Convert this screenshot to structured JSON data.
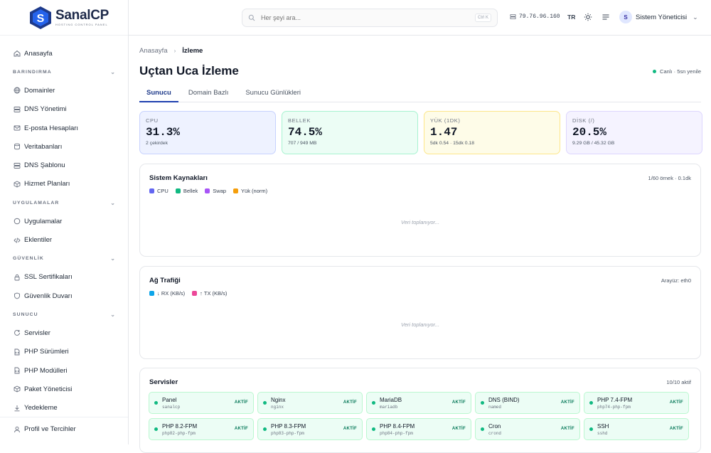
{
  "brand": {
    "name": "SanalCP",
    "tagline": "HOSTING CONTROL PANEL"
  },
  "sidebar": {
    "home": "Anasayfa",
    "sections": [
      {
        "label": "BARINDIRMA",
        "items": [
          "Domainler",
          "DNS Yönetimi",
          "E-posta Hesapları",
          "Veritabanları",
          "DNS Şablonu",
          "Hizmet Planları"
        ]
      },
      {
        "label": "UYGULAMALAR",
        "items": [
          "Uygulamalar",
          "Eklentiler"
        ]
      },
      {
        "label": "GÜVENLİK",
        "items": [
          "SSL Sertifikaları",
          "Güvenlik Duvarı"
        ]
      },
      {
        "label": "SUNUCU",
        "items": [
          "Servisler",
          "PHP Sürümleri",
          "PHP Modülleri",
          "Paket Yöneticisi",
          "Yedekleme"
        ]
      }
    ],
    "profile": "Profil ve Tercihler"
  },
  "topbar": {
    "search_placeholder": "Her şeyi ara...",
    "search_shortcut": "Ctrl K",
    "ip": "79.76.96.160",
    "lang": "TR",
    "user_initial": "S",
    "user_name": "Sistem Yöneticisi"
  },
  "breadcrumb": {
    "home": "Anasayfa",
    "current": "İzleme"
  },
  "page": {
    "title": "Uçtan Uca İzleme",
    "live": "Canlı · 5sn yenile"
  },
  "tabs": [
    "Sunucu",
    "Domain Bazlı",
    "Sunucu Günlükleri"
  ],
  "stats": [
    {
      "label": "CPU",
      "value": "31.3%",
      "sub": "2 çekirdek",
      "bg": "#eef2ff",
      "border": "#c7d2fe"
    },
    {
      "label": "BELLEK",
      "value": "74.5%",
      "sub": "707 / 949 MB",
      "bg": "#ecfdf5",
      "border": "#a7f3d0"
    },
    {
      "label": "YÜK (1DK)",
      "value": "1.47",
      "sub": "5dk 0.54 · 15dk 0.18",
      "bg": "#fefce8",
      "border": "#fde68a"
    },
    {
      "label": "DİSK (/)",
      "value": "20.5%",
      "sub": "9.29 GB / 45.32 GB",
      "bg": "#f5f3ff",
      "border": "#ddd6fe"
    }
  ],
  "resources": {
    "title": "Sistem Kaynakları",
    "meta": "1/60 örnek · 0.1dk",
    "legend": [
      {
        "label": "CPU",
        "color": "#6366f1"
      },
      {
        "label": "Bellek",
        "color": "#10b981"
      },
      {
        "label": "Swap",
        "color": "#a855f7"
      },
      {
        "label": "Yük (norm)",
        "color": "#f59e0b"
      }
    ],
    "empty": "Veri toplanıyor..."
  },
  "traffic": {
    "title": "Ağ Trafiği",
    "meta": "Arayüz: eth0",
    "legend": [
      {
        "label": "↓ RX (KB/s)",
        "color": "#0ea5e9"
      },
      {
        "label": "↑ TX (KB/s)",
        "color": "#ec4899"
      }
    ],
    "empty": "Veri toplanıyor..."
  },
  "services": {
    "title": "Servisler",
    "meta": "10/10 aktif",
    "items": [
      {
        "name": "Panel",
        "unit": "sanalcp",
        "status": "AKTİF"
      },
      {
        "name": "Nginx",
        "unit": "nginx",
        "status": "AKTİF"
      },
      {
        "name": "MariaDB",
        "unit": "mariadb",
        "status": "AKTİF"
      },
      {
        "name": "DNS (BIND)",
        "unit": "named",
        "status": "AKTİF"
      },
      {
        "name": "PHP 7.4-FPM",
        "unit": "php74-php-fpm",
        "status": "AKTİF"
      },
      {
        "name": "PHP 8.2-FPM",
        "unit": "php82-php-fpm",
        "status": "AKTİF"
      },
      {
        "name": "PHP 8.3-FPM",
        "unit": "php83-php-fpm",
        "status": "AKTİF"
      },
      {
        "name": "PHP 8.4-FPM",
        "unit": "php84-php-fpm",
        "status": "AKTİF"
      },
      {
        "name": "Cron",
        "unit": "crond",
        "status": "AKTİF"
      },
      {
        "name": "SSH",
        "unit": "sshd",
        "status": "AKTİF"
      }
    ]
  }
}
